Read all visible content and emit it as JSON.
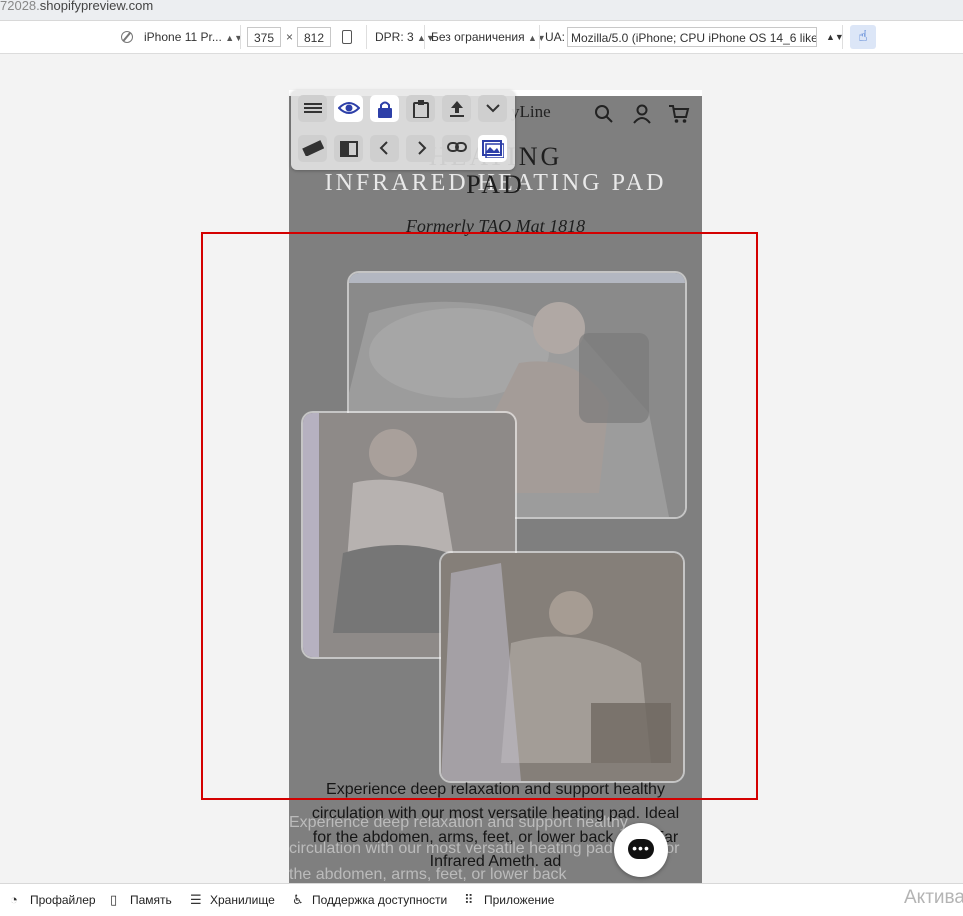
{
  "url": {
    "prefix": "72028.",
    "host": "shopifypreview.com"
  },
  "device_toolbar": {
    "device": "iPhone 11 Pr...",
    "width": "375",
    "times": "×",
    "height": "812",
    "dpr": "DPR: 3",
    "throttle": "Без ограничения",
    "ua_label": "UA:",
    "ua_value": "Mozilla/5.0 (iPhone; CPU iPhone OS 14_6 like I"
  },
  "page": {
    "logo": "yLine",
    "title_line1": "HEATING",
    "title_line2": "INFRARED HEATING PAD",
    "title_line3": "PAD",
    "subtitle": "Formerly TAO Mat 1818",
    "body_text": "Experience deep relaxation and support healthy circulation with our most versatile heating pad. Ideal for the abdomen, arms, feet, or lower back - the Far Infrared Ameth. ad",
    "body_ghost": "Experience deep relaxation and support healthy circulation with our most versatile heating pad. Ideal for the abdomen, arms, feet, or lower back"
  },
  "drawer": {
    "profiler": "Профайлер",
    "memory": "Память",
    "storage": "Хранилище",
    "accessibility": "Поддержка доступности",
    "application": "Приложение",
    "activate": "Актива"
  },
  "icons": {
    "header": [
      "search-icon",
      "account-icon",
      "cart-icon"
    ],
    "tools": [
      "menu-icon",
      "eye-icon",
      "lock-icon",
      "clipboard-icon",
      "upload-icon",
      "chevron-down-icon",
      "ruler-icon",
      "split-view-icon",
      "chevron-left-icon",
      "chevron-right-icon",
      "link-icon",
      "image-icon"
    ]
  },
  "colors": {
    "selection": "#d40000",
    "accent": "#2d3fa8",
    "overlay_gray": "#7f7f7f"
  }
}
